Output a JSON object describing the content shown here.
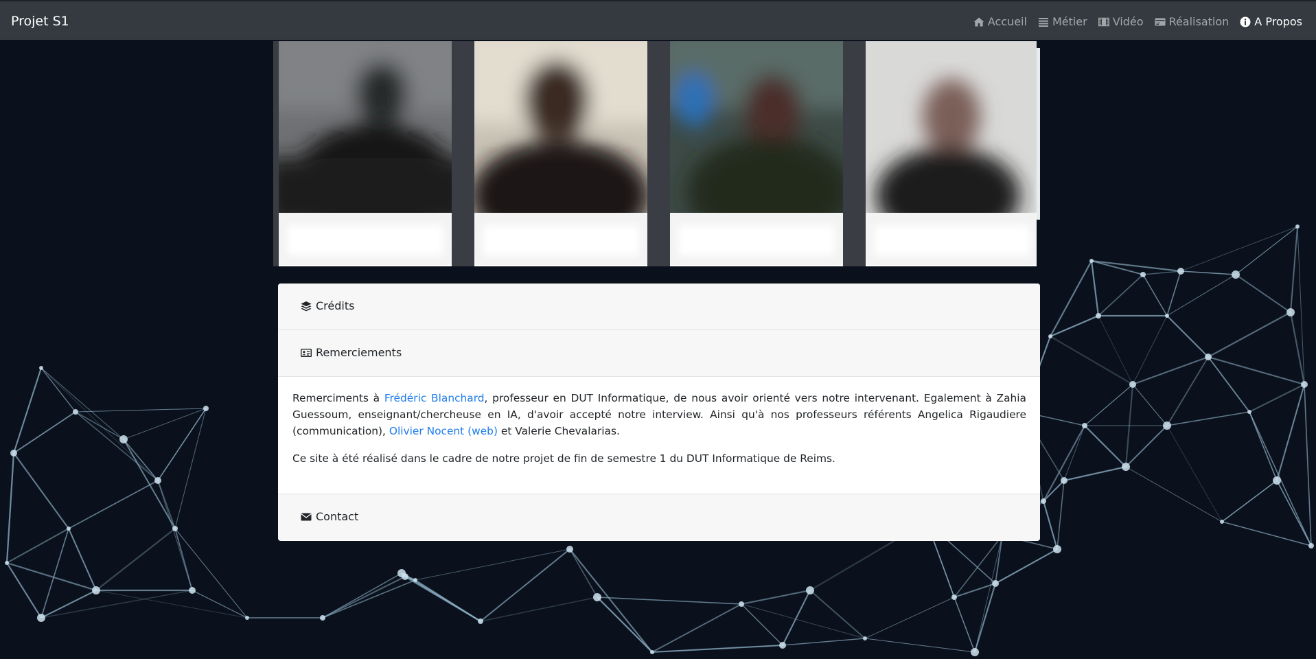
{
  "navbar": {
    "brand": "Projet S1",
    "items": [
      {
        "icon": "home-icon",
        "label": "Accueil",
        "active": false
      },
      {
        "icon": "list-icon",
        "label": "Métier",
        "active": false
      },
      {
        "icon": "film-icon",
        "label": "Vidéo",
        "active": false
      },
      {
        "icon": "card-icon",
        "label": "Réalisation",
        "active": false
      },
      {
        "icon": "info-circle-icon",
        "label": "A Propos",
        "active": true
      }
    ]
  },
  "accordion": {
    "credits_label": "Crédits",
    "remerciements_label": "Remerciements",
    "contact_label": "Contact",
    "body": {
      "p1_text1": "Remerciments à ",
      "p1_link1": "Frédéric Blanchard",
      "p1_text2": ", professeur en DUT Informatique, de nous avoir orienté vers notre intervenant. Egalement à Zahia Guessoum, enseignant/chercheuse en IA, d'avoir accepté notre interview. Ainsi qu'à nos professeurs référents Angelica Rigaudiere (communication), ",
      "p1_link2": "Olivier Nocent (web)",
      "p1_text3": " et Valerie Chevalarias.",
      "p2": "Ce site à été réalisé dans le cadre de notre projet de fin de semestre 1 du DUT Informatique de Reims."
    }
  },
  "colors": {
    "navbar_bg": "#343a40",
    "link": "#1f7dea",
    "page_bg": "#0b111c",
    "network": "#8fb3c9"
  }
}
